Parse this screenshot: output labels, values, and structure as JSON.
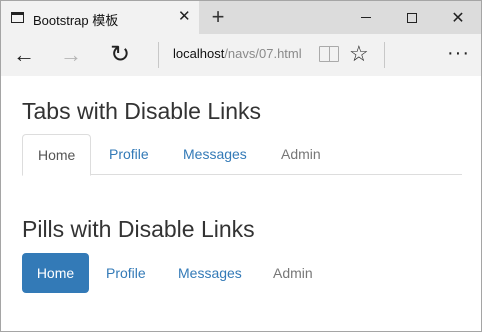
{
  "browser": {
    "tab_title": "Bootstrap 模板",
    "close_glyph": "✕",
    "new_tab_glyph": "+",
    "url_host": "localhost",
    "url_path": "/navs/07.html",
    "icons": {
      "tab": "page-icon",
      "back": "back-arrow-icon",
      "forward": "forward-arrow-icon",
      "refresh": "refresh-icon",
      "reading": "reading-view-icon",
      "favorite": "star-icon",
      "more": "more-icon"
    }
  },
  "tabs_section": {
    "title": "Tabs with Disable Links",
    "items": [
      {
        "label": "Home",
        "state": "active"
      },
      {
        "label": "Profile",
        "state": "link"
      },
      {
        "label": "Messages",
        "state": "link"
      },
      {
        "label": "Admin",
        "state": "disabled"
      }
    ]
  },
  "pills_section": {
    "title": "Pills with Disable Links",
    "items": [
      {
        "label": "Home",
        "state": "active"
      },
      {
        "label": "Profile",
        "state": "link"
      },
      {
        "label": "Messages",
        "state": "link"
      },
      {
        "label": "Admin",
        "state": "disabled"
      }
    ]
  },
  "colors": {
    "link": "#337ab7",
    "active_pill_bg": "#337ab7",
    "disabled_text": "#777777",
    "heading_text": "#333333"
  }
}
